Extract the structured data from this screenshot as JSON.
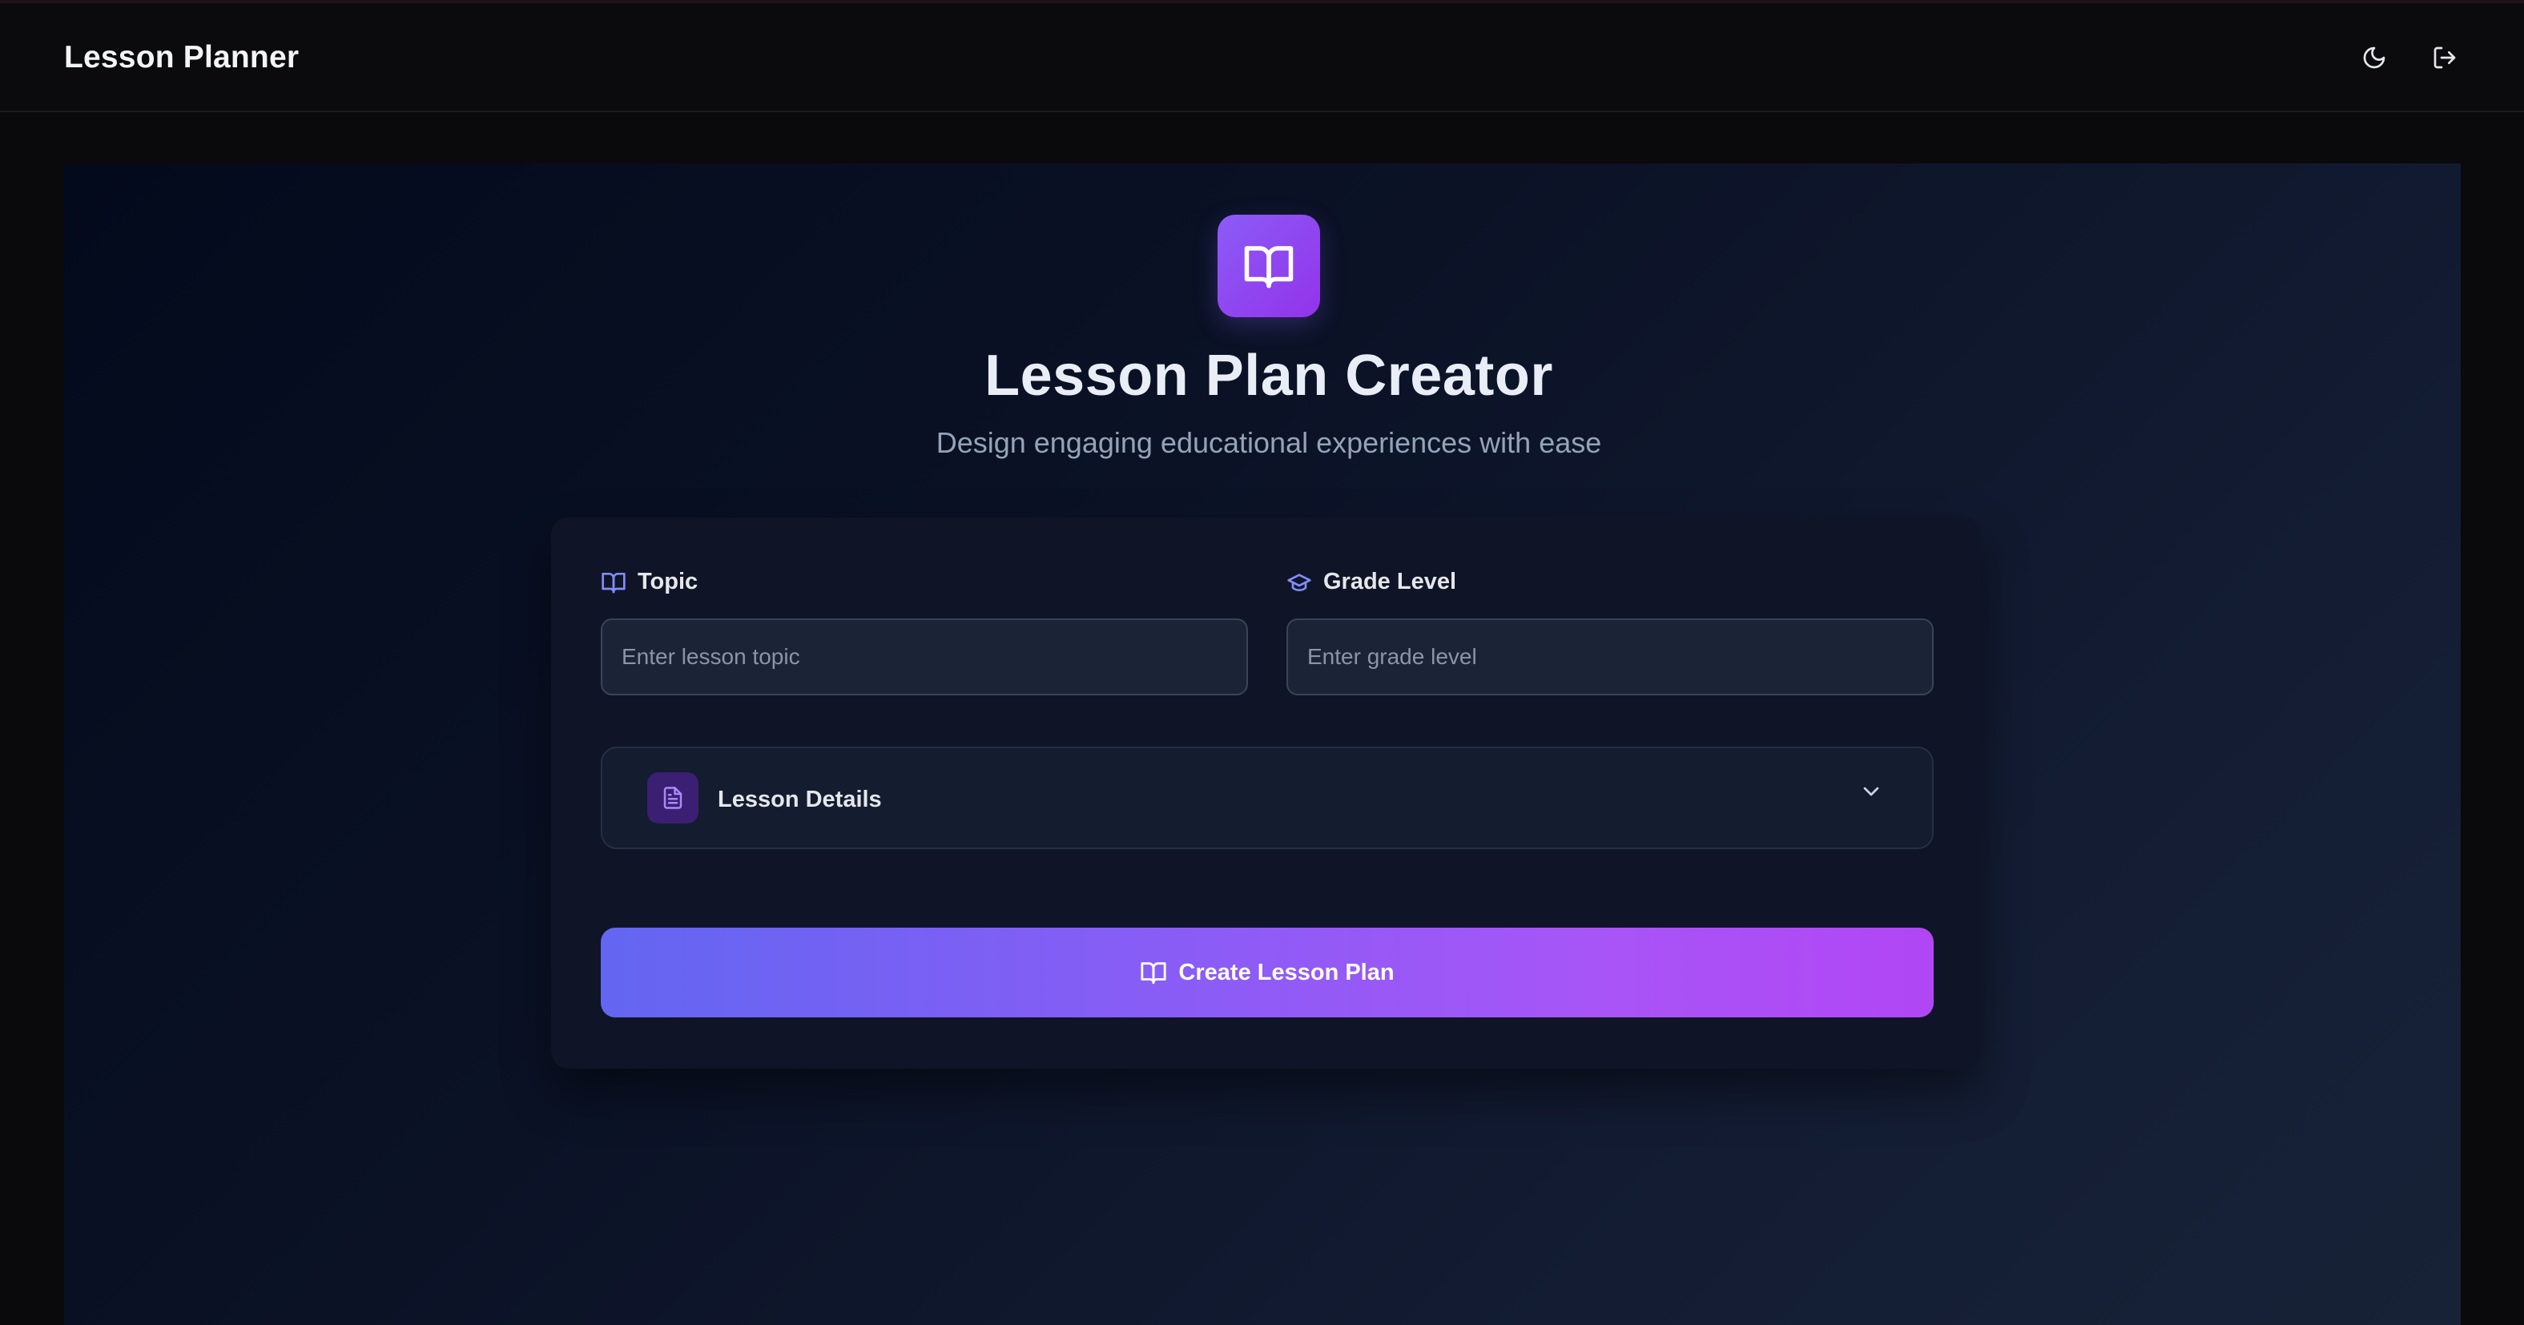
{
  "header": {
    "brand": "Lesson Planner",
    "icons": {
      "theme": "moon-icon",
      "logout": "logout-icon"
    }
  },
  "hero": {
    "icon": "book-open-icon",
    "title": "Lesson Plan Creator",
    "subtitle": "Design engaging educational experiences with ease"
  },
  "form": {
    "topic": {
      "label": "Topic",
      "value": "",
      "placeholder": "Enter lesson topic",
      "icon": "book-open-icon"
    },
    "grade": {
      "label": "Grade Level",
      "value": "",
      "placeholder": "Enter grade level",
      "icon": "graduation-cap-icon"
    },
    "details": {
      "label": "Lesson Details",
      "icon": "file-text-icon",
      "expanded": false
    },
    "submit": {
      "label": "Create Lesson Plan",
      "icon": "book-open-icon"
    }
  },
  "colors": {
    "accent": "#8b5cf6",
    "accent_end": "#a855f7",
    "button_start": "#6366f1",
    "background": "#0a0a0c",
    "card": "#0f1526"
  }
}
